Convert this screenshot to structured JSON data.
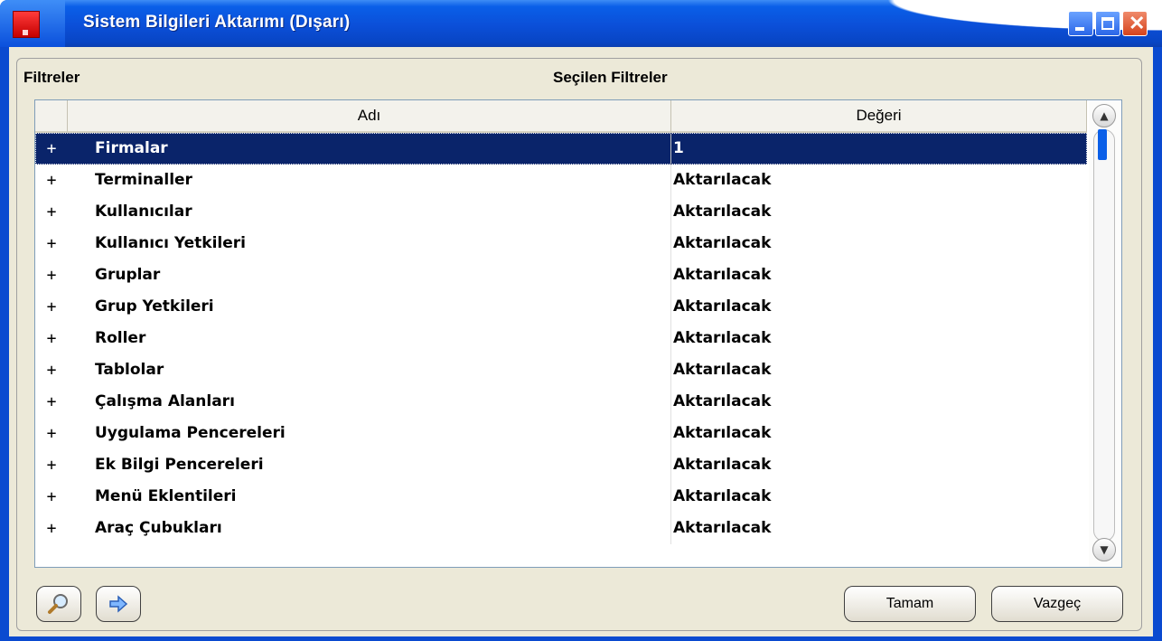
{
  "window": {
    "title": "Sistem Bilgileri Aktarımı (Dışarı)"
  },
  "labels": {
    "filters": "Filtreler",
    "selected_filters": "Seçilen Filtreler"
  },
  "grid": {
    "columns": [
      "Adı",
      "Değeri"
    ],
    "rows": [
      {
        "expander": "+",
        "name": "Firmalar",
        "value": "1",
        "selected": true
      },
      {
        "expander": "+",
        "name": "Terminaller",
        "value": "Aktarılacak"
      },
      {
        "expander": "+",
        "name": "Kullanıcılar",
        "value": "Aktarılacak"
      },
      {
        "expander": "+",
        "name": "Kullanıcı Yetkileri",
        "value": "Aktarılacak"
      },
      {
        "expander": "+",
        "name": "Gruplar",
        "value": "Aktarılacak"
      },
      {
        "expander": "+",
        "name": "Grup Yetkileri",
        "value": "Aktarılacak"
      },
      {
        "expander": "+",
        "name": "Roller",
        "value": "Aktarılacak"
      },
      {
        "expander": "+",
        "name": "Tablolar",
        "value": "Aktarılacak"
      },
      {
        "expander": "+",
        "name": "Çalışma Alanları",
        "value": "Aktarılacak"
      },
      {
        "expander": "+",
        "name": "Uygulama Pencereleri",
        "value": "Aktarılacak"
      },
      {
        "expander": "+",
        "name": "Ek Bilgi Pencereleri",
        "value": "Aktarılacak"
      },
      {
        "expander": "+",
        "name": "Menü Eklentileri",
        "value": "Aktarılacak"
      },
      {
        "expander": "+",
        "name": "Araç Çubukları",
        "value": "Aktarılacak"
      }
    ]
  },
  "buttons": {
    "search_icon": "search-icon",
    "forward_icon": "arrow-right-icon",
    "ok_label": "Tamam",
    "cancel_label": "Vazgeç"
  },
  "colors": {
    "selection": "#0a246a",
    "titlebar": "#0b4fd8"
  }
}
